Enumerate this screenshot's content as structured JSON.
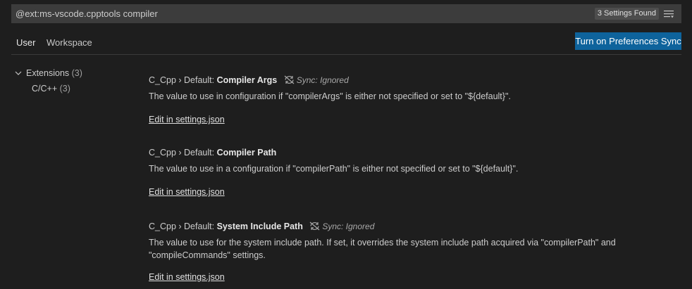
{
  "search": {
    "value": "@ext:ms-vscode.cpptools compiler",
    "count_label": "3 Settings Found"
  },
  "tabs": [
    {
      "label": "User",
      "active": true
    },
    {
      "label": "Workspace",
      "active": false
    }
  ],
  "sync_button_label": "Turn on Preferences Sync",
  "toc": {
    "extensions": {
      "label": "Extensions",
      "count": "(3)"
    },
    "cpp": {
      "label": "C/C++",
      "count": "(3)"
    }
  },
  "settings": [
    {
      "category": "C_Cpp › Default: ",
      "name": "Compiler Args",
      "sync_note": "Sync: Ignored",
      "description": "The value to use in configuration if \"compilerArgs\" is either not specified or set to \"${default}\".",
      "link": "Edit in settings.json"
    },
    {
      "category": "C_Cpp › Default: ",
      "name": "Compiler Path",
      "sync_note": "",
      "description": "The value to use in a configuration if \"compilerPath\" is either not specified or set to \"${default}\".",
      "link": "Edit in settings.json"
    },
    {
      "category": "C_Cpp › Default: ",
      "name": "System Include Path",
      "sync_note": "Sync: Ignored",
      "description_line1": "The value to use for the system include path. If set, it overrides the system include path acquired via \"compilerPath\" and",
      "description_line2": "\"compileCommands\" settings.",
      "link": "Edit in settings.json"
    }
  ],
  "icons": {
    "filter": "filter-list-icon",
    "chevron": "chevron-down-icon",
    "sync_ignored": "sync-ignored-icon"
  },
  "colors": {
    "background": "#1e1e1e",
    "input_background": "#3c3c3c",
    "button_background": "#0e639c",
    "foreground": "#cccccc"
  }
}
